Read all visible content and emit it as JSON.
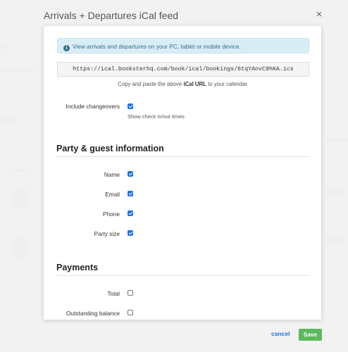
{
  "modal": {
    "title": "Arrivals + Departures iCal feed",
    "close_glyph": "×"
  },
  "info": {
    "icon": "info-icon",
    "text": "View arrivals and departures on your PC, tablet or mobile device."
  },
  "ical": {
    "url": "https://ical.booksterhq.com/book/ical/bookings/6tqYAnvC9hKA.ics",
    "hint_prefix": "Copy and paste the above",
    "hint_bold": "iCal URL",
    "hint_suffix": "to your calendar."
  },
  "changeovers": {
    "label": "Include changeovers",
    "checked": true,
    "hint": "Show check in/out times"
  },
  "party_section": {
    "title": "Party & guest information",
    "fields": [
      {
        "label": "Name",
        "checked": true
      },
      {
        "label": "Email",
        "checked": true
      },
      {
        "label": "Phone",
        "checked": true
      },
      {
        "label": "Party size",
        "checked": true
      }
    ]
  },
  "payments_section": {
    "title": "Payments",
    "fields": [
      {
        "label": "Total",
        "checked": false
      },
      {
        "label": "Outstanding balance",
        "checked": false
      }
    ]
  },
  "footer": {
    "cancel_label": "cancel",
    "save_label": "Save",
    "save_color": "#5cb85c",
    "link_color": "#1a73e8"
  }
}
